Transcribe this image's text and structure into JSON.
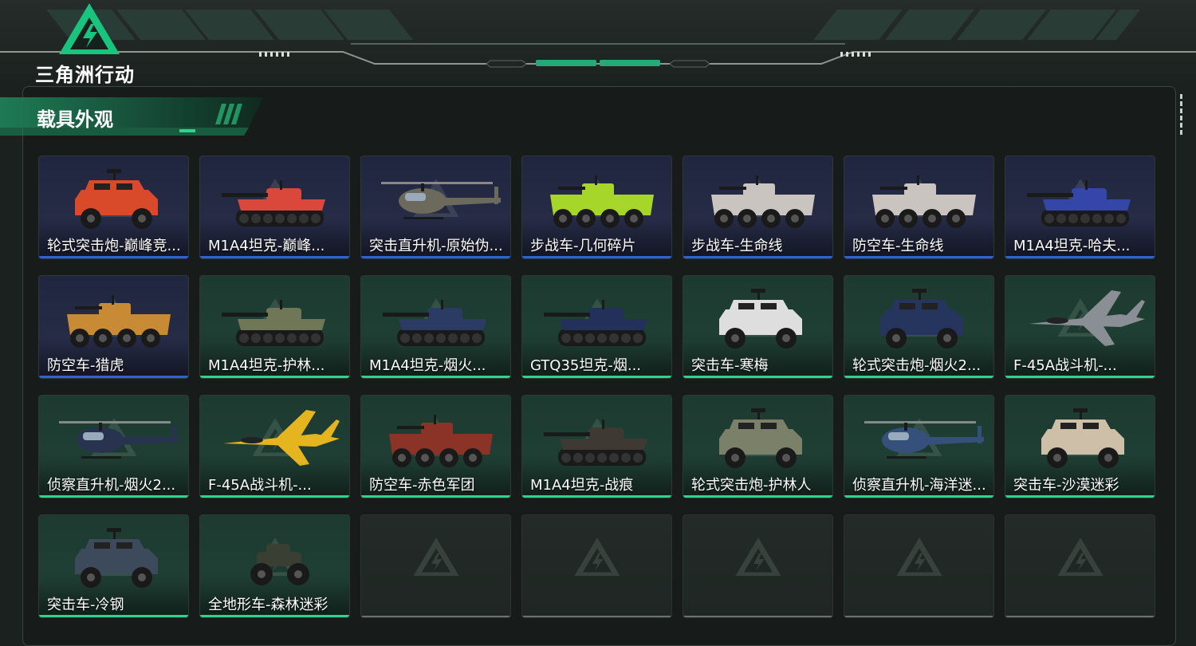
{
  "app": {
    "logo_text": "三角洲行动"
  },
  "panel": {
    "title": "载具外观"
  },
  "colors": {
    "accent_green": "#2fd38a",
    "rare_blue": "#2e63d6",
    "empty_gray": "#6b7370"
  },
  "vehicles": [
    {
      "name": "轮式突击炮-巅峰竞...",
      "rarity": "blue",
      "kind": "armored-car",
      "color": "#d94a2a"
    },
    {
      "name": "M1A4坦克-巅峰...",
      "rarity": "blue",
      "kind": "tank",
      "color": "#d9483a"
    },
    {
      "name": "突击直升机-原始伪...",
      "rarity": "blue",
      "kind": "helicopter",
      "color": "#6c6a5c"
    },
    {
      "name": "步战车-几何碎片",
      "rarity": "blue",
      "kind": "apc",
      "color": "#a7d62a"
    },
    {
      "name": "步战车-生命线",
      "rarity": "blue",
      "kind": "apc",
      "color": "#c9c4c0"
    },
    {
      "name": "防空车-生命线",
      "rarity": "blue",
      "kind": "apc",
      "color": "#c9c4c0"
    },
    {
      "name": "M1A4坦克-哈夫...",
      "rarity": "blue",
      "kind": "tank",
      "color": "#3447a8"
    },
    {
      "name": "防空车-猎虎",
      "rarity": "blue",
      "kind": "apc",
      "color": "#c98a36"
    },
    {
      "name": "M1A4坦克-护林...",
      "rarity": "green",
      "kind": "tank",
      "color": "#6f7756"
    },
    {
      "name": "M1A4坦克-烟火...",
      "rarity": "green",
      "kind": "tank",
      "color": "#2b3b63"
    },
    {
      "name": "GTQ35坦克-烟...",
      "rarity": "green",
      "kind": "tank",
      "color": "#22305a"
    },
    {
      "name": "突击车-寒梅",
      "rarity": "green",
      "kind": "armored-car",
      "color": "#dedede"
    },
    {
      "name": "轮式突击炮-烟火2...",
      "rarity": "green",
      "kind": "armored-car",
      "color": "#26355e"
    },
    {
      "name": "F-45A战斗机-...",
      "rarity": "green",
      "kind": "jet",
      "color": "#8a8f95"
    },
    {
      "name": "侦察直升机-烟火2...",
      "rarity": "green",
      "kind": "helicopter",
      "color": "#283350"
    },
    {
      "name": "F-45A战斗机-...",
      "rarity": "green",
      "kind": "jet",
      "color": "#e5b51f"
    },
    {
      "name": "防空车-赤色军团",
      "rarity": "green",
      "kind": "apc",
      "color": "#8a3326"
    },
    {
      "name": "M1A4坦克-战痕",
      "rarity": "green",
      "kind": "tank",
      "color": "#3e3a33"
    },
    {
      "name": "轮式突击炮-护林人",
      "rarity": "green",
      "kind": "armored-car",
      "color": "#7b8169"
    },
    {
      "name": "侦察直升机-海洋迷...",
      "rarity": "green",
      "kind": "helicopter",
      "color": "#35507a"
    },
    {
      "name": "突击车-沙漠迷彩",
      "rarity": "green",
      "kind": "armored-car",
      "color": "#cdbfa8"
    },
    {
      "name": "突击车-冷钢",
      "rarity": "green",
      "kind": "armored-car",
      "color": "#3d4a5c"
    },
    {
      "name": "全地形车-森林迷彩",
      "rarity": "green",
      "kind": "atv",
      "color": "#3a3f33"
    },
    {
      "name": "",
      "rarity": "empty"
    },
    {
      "name": "",
      "rarity": "empty"
    },
    {
      "name": "",
      "rarity": "empty"
    },
    {
      "name": "",
      "rarity": "empty"
    },
    {
      "name": "",
      "rarity": "empty"
    }
  ]
}
